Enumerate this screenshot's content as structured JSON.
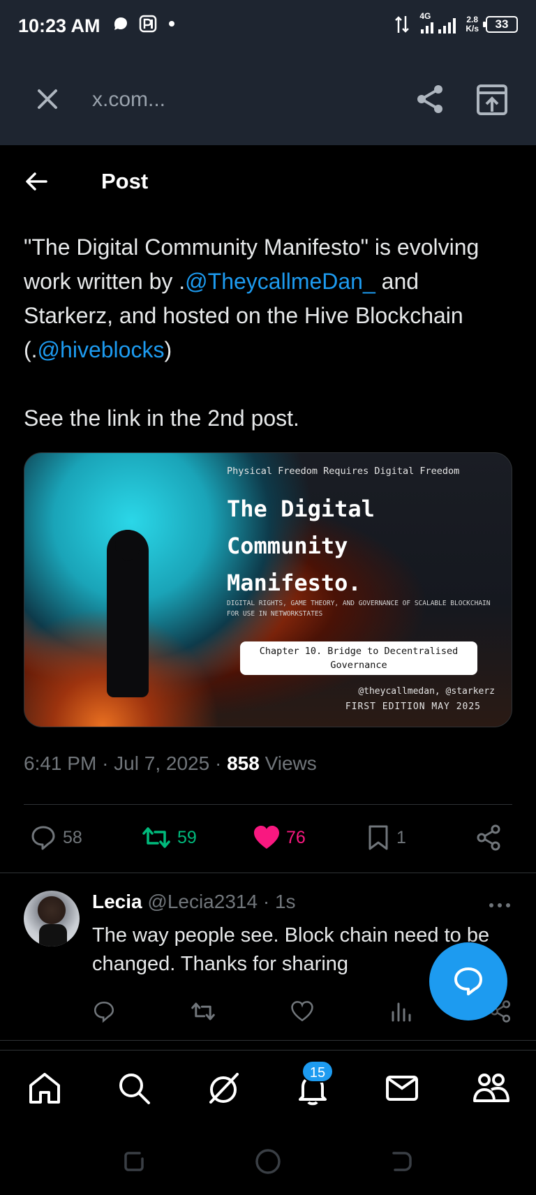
{
  "status_bar": {
    "time": "10:23 AM",
    "network": "4G",
    "speed_value": "2.8",
    "speed_unit": "K/s",
    "battery": "33"
  },
  "browser": {
    "url": "x.com..."
  },
  "header": {
    "title": "Post"
  },
  "post": {
    "text_1": "\"The Digital Community Manifesto\" is evolving work written by .",
    "mention_1": "@TheycallmeDan_",
    "text_2": " and Starkerz, and hosted on the Hive Blockchain (.",
    "mention_2": "@hiveblocks",
    "text_3": ")",
    "text_4": "See the link in the 2nd post.",
    "time": "6:41 PM",
    "date": "Jul 7, 2025",
    "views_count": "858",
    "views_label": "Views"
  },
  "media": {
    "tagline": "Physical Freedom Requires Digital Freedom",
    "title": "The Digital\nCommunity\nManifesto.",
    "subtitle": "DIGITAL RIGHTS, GAME THEORY, AND GOVERNANCE OF SCALABLE BLOCKCHAIN FOR USE IN NETWORKSTATES",
    "chapter": "Chapter 10. Bridge to Decentralised Governance",
    "authors": "@theycallmedan, @starkerz",
    "edition": "FIRST EDITION MAY 2025"
  },
  "stats": {
    "replies": "58",
    "reposts": "59",
    "likes": "76",
    "bookmarks": "1"
  },
  "reply": {
    "name": "Lecia",
    "handle": "@Lecia2314",
    "time": "1s",
    "text": "The way people see. Block chain need to be changed. Thanks for sharing"
  },
  "nav": {
    "notifications_badge": "15"
  },
  "colors": {
    "accent": "#1d9bf0",
    "repost": "#00ba7c",
    "like": "#f91880",
    "muted": "#71767b"
  }
}
